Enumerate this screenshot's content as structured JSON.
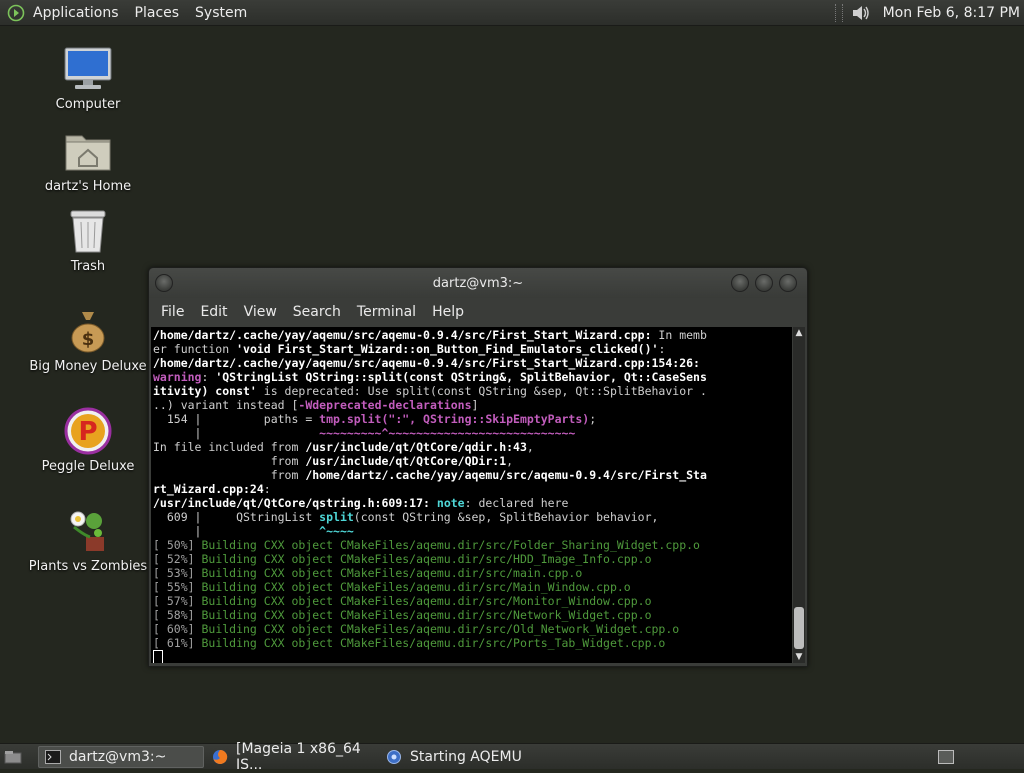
{
  "top_panel": {
    "menus": [
      "Applications",
      "Places",
      "System"
    ],
    "clock": "Mon Feb  6,  8:17 PM",
    "icons": {
      "main": "gnome-foot-icon",
      "volume": "volume-icon"
    }
  },
  "desktop_icons": [
    {
      "label": "Computer",
      "icon": "computer-icon"
    },
    {
      "label": "dartz's Home",
      "icon": "home-folder-icon"
    },
    {
      "label": "Trash",
      "icon": "trash-icon"
    },
    {
      "label": "Big Money Deluxe",
      "icon": "money-bag-icon"
    },
    {
      "label": "Peggle Deluxe",
      "icon": "peggle-icon"
    },
    {
      "label": "Plants vs Zombies",
      "icon": "plants-icon"
    }
  ],
  "terminal": {
    "title": "dartz@vm3:~",
    "menu": [
      "File",
      "Edit",
      "View",
      "Search",
      "Terminal",
      "Help"
    ],
    "lines": [
      [
        {
          "t": "/home/dartz/.cache/yay/aqemu/src/aqemu-0.9.4/src/First_Start_Wizard.cpp:",
          "c": "w"
        },
        {
          "t": " In memb",
          "c": "g"
        }
      ],
      [
        {
          "t": "er function ",
          "c": "g"
        },
        {
          "t": "'void First_Start_Wizard::on_Button_Find_Emulators_clicked()'",
          "c": "w"
        },
        {
          "t": ":",
          "c": "g"
        }
      ],
      [
        {
          "t": "/home/dartz/.cache/yay/aqemu/src/aqemu-0.9.4/src/First_Start_Wizard.cpp:154:26:",
          "c": "w"
        }
      ],
      [
        {
          "t": "warning",
          "c": "m"
        },
        {
          "t": ": ",
          "c": "g"
        },
        {
          "t": "'QStringList QString::split(const QString&, SplitBehavior, Qt::CaseSens",
          "c": "w"
        }
      ],
      [
        {
          "t": "itivity) const'",
          "c": "w"
        },
        {
          "t": " is deprecated: Use split(const QString &sep, Qt::SplitBehavior .",
          "c": "g"
        }
      ],
      [
        {
          "t": "..) variant instead [",
          "c": "g"
        },
        {
          "t": "-Wdeprecated-declarations",
          "c": "m"
        },
        {
          "t": "]",
          "c": "g"
        }
      ],
      [
        {
          "t": "  154 |         paths = ",
          "c": "g"
        },
        {
          "t": "tmp.split(\":\", QString::SkipEmptyParts)",
          "c": "m"
        },
        {
          "t": ";",
          "c": "g"
        }
      ],
      [
        {
          "t": "      |                 ",
          "c": "g"
        },
        {
          "t": "~~~~~~~~~^~~~~~~~~~~~~~~~~~~~~~~~~~~~",
          "c": "m"
        }
      ],
      [
        {
          "t": "In file included from ",
          "c": "g"
        },
        {
          "t": "/usr/include/qt/QtCore/qdir.h:43",
          "c": "w"
        },
        {
          "t": ",",
          "c": "g"
        }
      ],
      [
        {
          "t": "                 from ",
          "c": "g"
        },
        {
          "t": "/usr/include/qt/QtCore/QDir:1",
          "c": "w"
        },
        {
          "t": ",",
          "c": "g"
        }
      ],
      [
        {
          "t": "                 from ",
          "c": "g"
        },
        {
          "t": "/home/dartz/.cache/yay/aqemu/src/aqemu-0.9.4/src/First_Sta",
          "c": "w"
        }
      ],
      [
        {
          "t": "rt_Wizard.cpp:24",
          "c": "w"
        },
        {
          "t": ":",
          "c": "g"
        }
      ],
      [
        {
          "t": "/usr/include/qt/QtCore/qstring.h:609:17:",
          "c": "w"
        },
        {
          "t": " ",
          "c": "g"
        },
        {
          "t": "note",
          "c": "cy"
        },
        {
          "t": ": declared here",
          "c": "g"
        }
      ],
      [
        {
          "t": "  609 |     QStringList ",
          "c": "g"
        },
        {
          "t": "split",
          "c": "cy"
        },
        {
          "t": "(const QString &sep, SplitBehavior behavior,",
          "c": "g"
        }
      ],
      [
        {
          "t": "      |                 ",
          "c": "g"
        },
        {
          "t": "^~~~~",
          "c": "cy"
        }
      ],
      [
        {
          "t": "[ 50%] ",
          "c": "gn"
        },
        {
          "t": "Building CXX object CMakeFiles/aqemu.dir/src/Folder_Sharing_Widget.cpp.o",
          "c": "dg"
        }
      ],
      [
        {
          "t": "[ 52%] ",
          "c": "gn"
        },
        {
          "t": "Building CXX object CMakeFiles/aqemu.dir/src/HDD_Image_Info.cpp.o",
          "c": "dg"
        }
      ],
      [
        {
          "t": "[ 53%] ",
          "c": "gn"
        },
        {
          "t": "Building CXX object CMakeFiles/aqemu.dir/src/main.cpp.o",
          "c": "dg"
        }
      ],
      [
        {
          "t": "[ 55%] ",
          "c": "gn"
        },
        {
          "t": "Building CXX object CMakeFiles/aqemu.dir/src/Main_Window.cpp.o",
          "c": "dg"
        }
      ],
      [
        {
          "t": "[ 57%] ",
          "c": "gn"
        },
        {
          "t": "Building CXX object CMakeFiles/aqemu.dir/src/Monitor_Window.cpp.o",
          "c": "dg"
        }
      ],
      [
        {
          "t": "[ 58%] ",
          "c": "gn"
        },
        {
          "t": "Building CXX object CMakeFiles/aqemu.dir/src/Network_Widget.cpp.o",
          "c": "dg"
        }
      ],
      [
        {
          "t": "[ 60%] ",
          "c": "gn"
        },
        {
          "t": "Building CXX object CMakeFiles/aqemu.dir/src/Old_Network_Widget.cpp.o",
          "c": "dg"
        }
      ],
      [
        {
          "t": "[ 61%] ",
          "c": "gn"
        },
        {
          "t": "Building CXX object CMakeFiles/aqemu.dir/src/Ports_Tab_Widget.cpp.o",
          "c": "dg"
        }
      ]
    ]
  },
  "taskbar": {
    "items": [
      {
        "label": "dartz@vm3:~",
        "icon": "terminal-icon",
        "active": true
      },
      {
        "label": "[Mageia 1 x86_64 IS...",
        "icon": "firefox-icon",
        "active": false
      },
      {
        "label": "Starting AQEMU",
        "icon": "aqemu-icon",
        "active": false
      }
    ]
  }
}
